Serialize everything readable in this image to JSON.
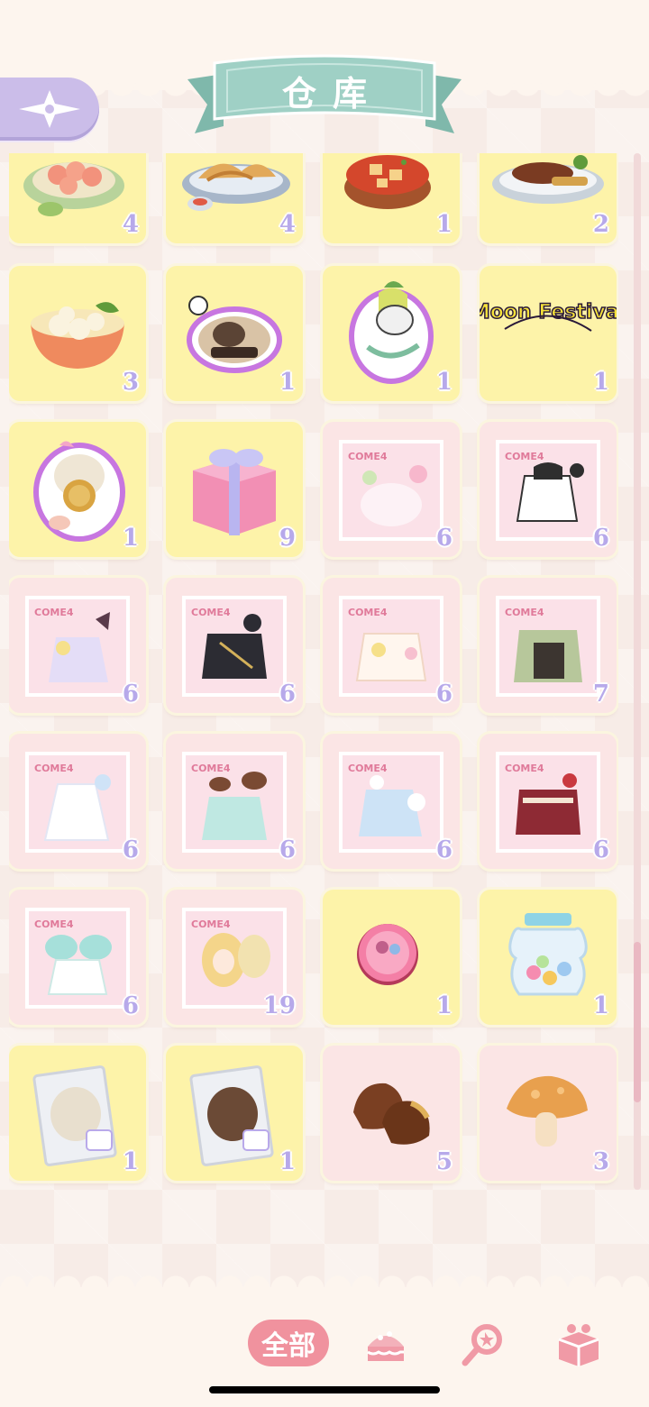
{
  "header": {
    "title": "仓库"
  },
  "filters": {
    "all_label": "全部",
    "icons": [
      "cake-filter-icon",
      "magnifier-filter-icon",
      "gift-box-filter-icon"
    ]
  },
  "colors": {
    "card": "#fdf3a9",
    "card_soft": "#fbe5e5",
    "count_text": "#b7a9ea",
    "accent_pink": "#f0929e",
    "ribbon": "#9fd0c5",
    "back_button": "#cbbde9"
  },
  "items": [
    {
      "icon": "shrimp-dish-icon",
      "count": "4"
    },
    {
      "icon": "fried-dumplings-icon",
      "count": "4"
    },
    {
      "icon": "mapo-tofu-icon",
      "count": "1"
    },
    {
      "icon": "braised-fish-dish-icon",
      "count": "2"
    },
    {
      "icon": "fish-ball-soup-icon",
      "count": "3"
    },
    {
      "icon": "siamese-cat-sticker-icon",
      "count": "1"
    },
    {
      "icon": "leaf-cat-sticker-icon",
      "count": "1"
    },
    {
      "icon": "moon-festival-sticker-icon",
      "count": "1"
    },
    {
      "text": "Moon Festival"
    },
    {
      "icon": "mooncake-cat-sticker-icon",
      "count": "1"
    },
    {
      "icon": "pink-gift-box-icon",
      "count": "9"
    },
    {
      "icon": "outfit-pack-pink-icon",
      "count": "6"
    },
    {
      "icon": "outfit-pack-black-white-icon",
      "count": "6"
    },
    {
      "icon": "outfit-pack-lilac-icon",
      "count": "6"
    },
    {
      "icon": "outfit-pack-dark-icon",
      "count": "6"
    },
    {
      "icon": "outfit-pack-cream-icon",
      "count": "6"
    },
    {
      "icon": "outfit-pack-green-icon",
      "count": "7"
    },
    {
      "icon": "outfit-pack-white-dress-icon",
      "count": "6"
    },
    {
      "icon": "outfit-pack-mint-icon",
      "count": "6"
    },
    {
      "icon": "outfit-pack-blue-icon",
      "count": "6"
    },
    {
      "icon": "outfit-pack-red-icon",
      "count": "6"
    },
    {
      "icon": "outfit-pack-teal-icon",
      "count": "6"
    },
    {
      "icon": "outfit-pack-blonde-icon",
      "count": "19"
    },
    {
      "icon": "pink-badge-icon",
      "count": "1"
    },
    {
      "icon": "candy-jar-icon",
      "count": "1"
    },
    {
      "icon": "white-wig-bag-icon",
      "count": "1"
    },
    {
      "icon": "brown-wig-bag-icon",
      "count": "1"
    },
    {
      "icon": "chestnuts-icon",
      "count": "5"
    },
    {
      "icon": "mushroom-icon",
      "count": "3"
    }
  ],
  "pack_brand": "COME4"
}
